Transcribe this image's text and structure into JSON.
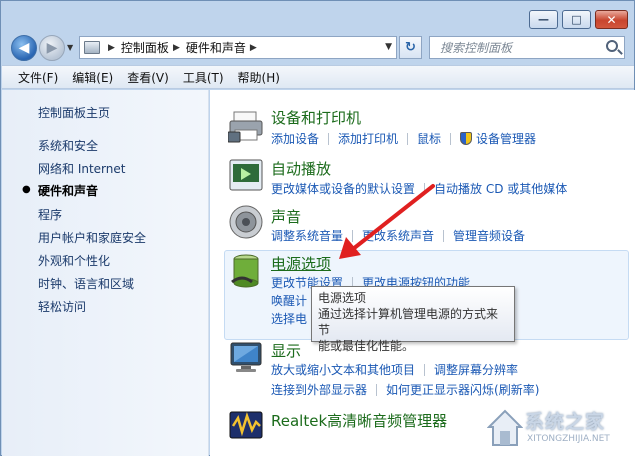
{
  "window": {
    "controls": {
      "minimize": "—",
      "maximize": "□",
      "close": "✕"
    }
  },
  "nav": {
    "back_icon": "arrow-left-icon",
    "forward_icon": "arrow-right-icon",
    "breadcrumb": [
      "控制面板",
      "硬件和声音"
    ],
    "refresh_icon": "refresh-icon",
    "search_placeholder": "搜索控制面板"
  },
  "menu": [
    "文件(F)",
    "编辑(E)",
    "查看(V)",
    "工具(T)",
    "帮助(H)"
  ],
  "sidebar": {
    "items": [
      {
        "label": "控制面板主页",
        "current": false
      },
      {
        "label": "系统和安全",
        "current": false
      },
      {
        "label": "网络和 Internet",
        "current": false
      },
      {
        "label": "硬件和声音",
        "current": true
      },
      {
        "label": "程序",
        "current": false
      },
      {
        "label": "用户帐户和家庭安全",
        "current": false
      },
      {
        "label": "外观和个性化",
        "current": false
      },
      {
        "label": "时钟、语言和区域",
        "current": false
      },
      {
        "label": "轻松访问",
        "current": false
      }
    ]
  },
  "categories": [
    {
      "title": "设备和打印机",
      "icon": "printer-icon",
      "links": [
        [
          "添加设备",
          "添加打印机",
          "鼠标",
          "设备管理器"
        ]
      ]
    },
    {
      "title": "自动播放",
      "icon": "autoplay-icon",
      "links": [
        [
          "更改媒体或设备的默认设置",
          "自动播放 CD 或其他媒体"
        ]
      ]
    },
    {
      "title": "声音",
      "icon": "speaker-icon",
      "links": [
        [
          "调整系统音量",
          "更改系统声音",
          "管理音频设备"
        ]
      ]
    },
    {
      "title": "电源选项",
      "icon": "battery-icon",
      "links": [
        [
          "更改节能设置",
          "更改电源按钮的功能"
        ],
        [
          "唤醒计"
        ],
        [
          "选择电"
        ]
      ]
    },
    {
      "title": "显示",
      "icon": "monitor-icon",
      "links": [
        [
          "放大或缩小文本和其他项目",
          "调整屏幕分辨率"
        ],
        [
          "连接到外部显示器",
          "如何更正显示器闪烁(刷新率)"
        ]
      ]
    },
    {
      "title": "Realtek高清晰音频管理器",
      "icon": "realtek-audio-icon",
      "links": []
    }
  ],
  "tooltip": {
    "title": "电源选项",
    "line1": "通过选择计算机管理电源的方式来节",
    "line2": "能或最佳化性能。"
  },
  "watermark": {
    "title": "系统之家",
    "subtitle": "XITONGZHIJIA.NET"
  },
  "colors": {
    "link": "#1a58b4",
    "category_title": "#1b6b1b",
    "annotation_arrow": "#e02020"
  }
}
